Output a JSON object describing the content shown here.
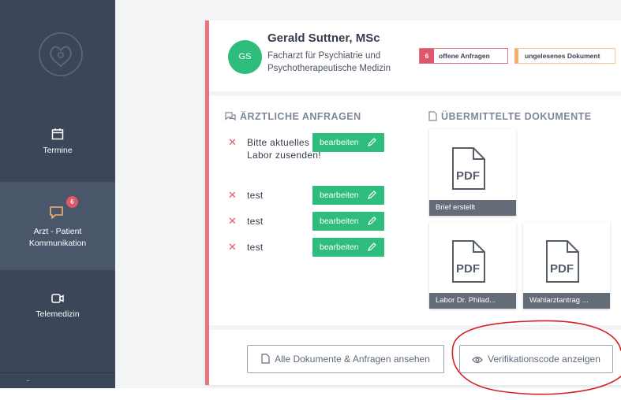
{
  "sidebar": {
    "items": [
      {
        "label": "Termine",
        "icon": "calendar-icon"
      },
      {
        "label": "Arzt - Patient\nKommunikation",
        "label_line1": "Arzt - Patient",
        "label_line2": "Kommunikation",
        "icon": "chat-icon",
        "badge": "6",
        "active": true
      },
      {
        "label": "Telemedizin",
        "icon": "video-icon"
      }
    ]
  },
  "doctor": {
    "initials": "GS",
    "name": "Gerald Suttner, MSc",
    "specialty": "Facharzt für Psychiatrie und Psychotherapeutische Medizin"
  },
  "badges": {
    "open_count": "6",
    "open_label": "offene Anfragen",
    "unread_label": "ungelesenes Dokument"
  },
  "anfragen": {
    "heading": "ÄRZTLICHE ANFRAGEN",
    "edit_label": "bearbeiten",
    "items": [
      {
        "text": "Bitte aktuelles Labor zusenden!"
      },
      {
        "text": "test"
      },
      {
        "text": "test"
      },
      {
        "text": "test"
      }
    ]
  },
  "documents": {
    "heading": "ÜBERMITTELTE DOKUMENTE",
    "pdf_label": "PDF",
    "items": [
      {
        "caption": "Brief erstellt"
      },
      {
        "caption": "Labor Dr. Philad..."
      },
      {
        "caption": "Wahlarztantrag ..."
      }
    ]
  },
  "footer": {
    "all_button": "Alle Dokumente & Anfragen ansehen",
    "verify_button": "Verifikationscode anzeigen"
  },
  "colors": {
    "sidebar": "#3b4658",
    "accent_green": "#2ebd7c",
    "accent_red": "#e0566b",
    "card_border": "#e8747f",
    "annotation": "#d42020"
  }
}
